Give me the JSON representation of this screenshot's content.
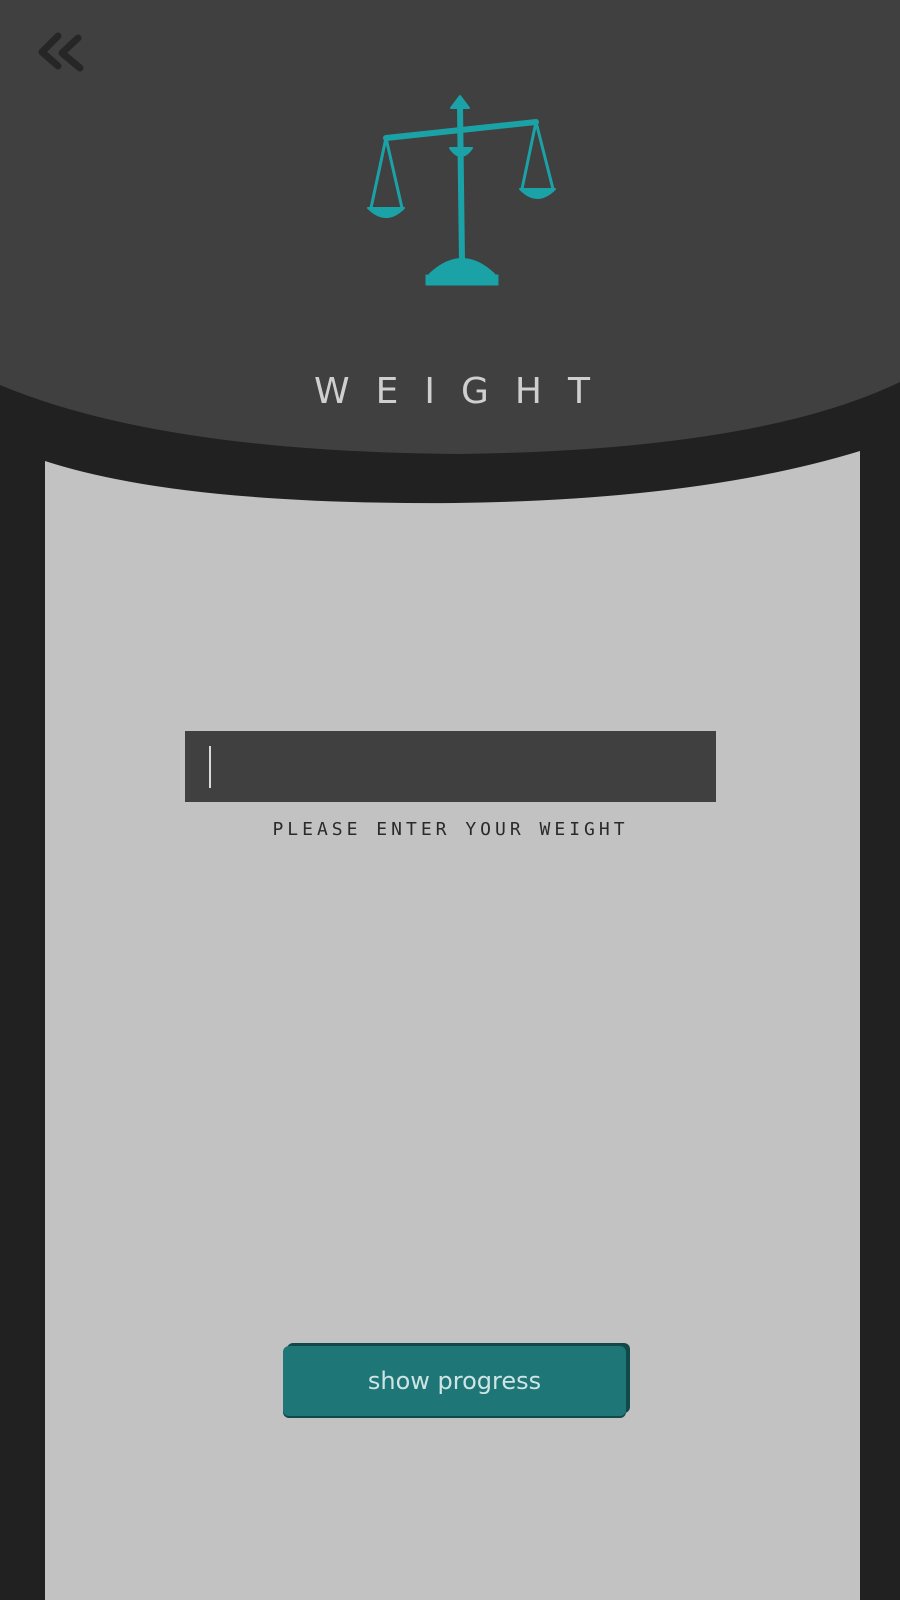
{
  "header": {
    "title": "WEIGHT",
    "back_icon": "double-chevron-left-icon",
    "logo_icon": "balance-scale-icon"
  },
  "form": {
    "weight_input_value": "",
    "weight_input_hint": "PLEASE ENTER YOUR WEIGHT"
  },
  "actions": {
    "show_progress_label": "show progress"
  },
  "colors": {
    "header_bg": "#404040",
    "page_bg": "#212121",
    "panel_bg": "#c2c2c2",
    "accent": "#1aa2a7",
    "button_bg": "#1e7677"
  }
}
